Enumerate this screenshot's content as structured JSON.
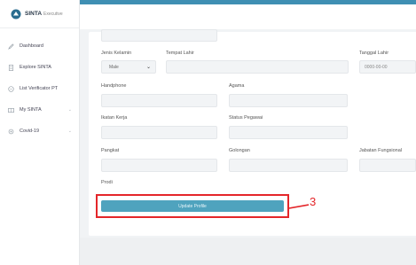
{
  "brand": {
    "name": "SINTA",
    "subtitle": "Executive"
  },
  "sidebar": {
    "items": [
      {
        "label": "Dashboard",
        "icon": "pencil-icon"
      },
      {
        "label": "Explore SINTA",
        "icon": "document-icon"
      },
      {
        "label": "List Verificator PT",
        "icon": "circle-icon"
      },
      {
        "label": "My SINTA",
        "icon": "grid-icon",
        "chevron": "⌄"
      },
      {
        "label": "Covid-19",
        "icon": "gear-icon",
        "chevron": "⌄"
      }
    ]
  },
  "form": {
    "jenis_kelamin": {
      "label": "Jenis Kelamin",
      "value": "Male",
      "caret": "⌄"
    },
    "tempat_lahir": {
      "label": "Tempat Lahir",
      "value": ""
    },
    "tanggal_lahir": {
      "label": "Tanggal Lahir",
      "placeholder": "0000-00-00"
    },
    "handphone": {
      "label": "Handphone",
      "value": ""
    },
    "agama": {
      "label": "Agama",
      "value": ""
    },
    "ikatan_kerja": {
      "label": "Ikatan Kerja",
      "value": ""
    },
    "status_pegawai": {
      "label": "Status Pegawai",
      "value": ""
    },
    "pangkat": {
      "label": "Pangkat",
      "value": ""
    },
    "golongan": {
      "label": "Golongan",
      "value": ""
    },
    "jabatan_fungsional": {
      "label": "Jabatan Fungsional",
      "value": ""
    },
    "prodi": {
      "label": "Prodi",
      "value": ""
    }
  },
  "update_button": {
    "label": "Update Profile"
  },
  "annotation": {
    "number": "3",
    "color": "#e4262a"
  },
  "colors": {
    "accent": "#3f8fb3",
    "button": "#4fa3be"
  }
}
